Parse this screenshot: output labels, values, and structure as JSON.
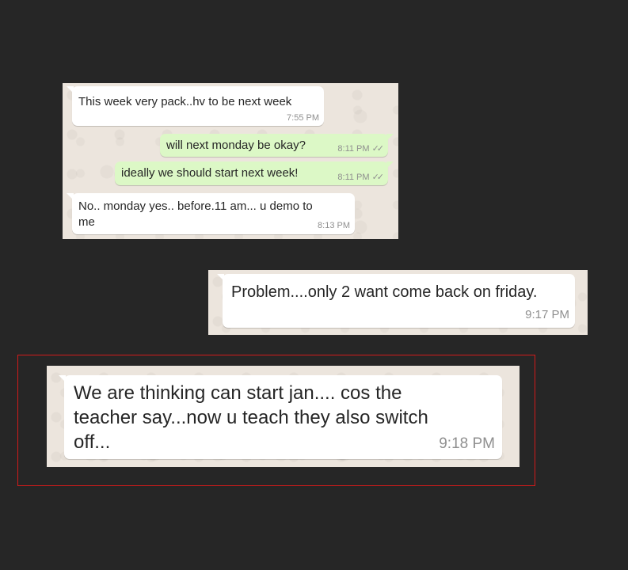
{
  "screenshot1": {
    "messages": [
      {
        "text": "This week very pack..hv to be next week",
        "time": "7:55 PM"
      },
      {
        "text": "will next monday be okay?",
        "time": "8:11 PM",
        "ticks": "✓✓"
      },
      {
        "text": "ideally we should start next week!",
        "time": "8:11 PM",
        "ticks": "✓✓"
      },
      {
        "text": "No.. monday yes.. before.11 am... u demo to me",
        "time": "8:13 PM"
      }
    ]
  },
  "screenshot2": {
    "message": {
      "text": "Problem....only 2 want come back on friday.",
      "time": "9:17 PM"
    }
  },
  "screenshot3": {
    "message": {
      "text": "We are thinking can start jan.... cos the teacher say...now u teach they also switch off...",
      "time": "9:18 PM"
    }
  },
  "colors": {
    "page_background": "#262626",
    "chat_background": "#ece5dd",
    "incoming_bubble": "#ffffff",
    "outgoing_bubble": "#dcf8c6",
    "highlight_border": "#d21a1a"
  }
}
